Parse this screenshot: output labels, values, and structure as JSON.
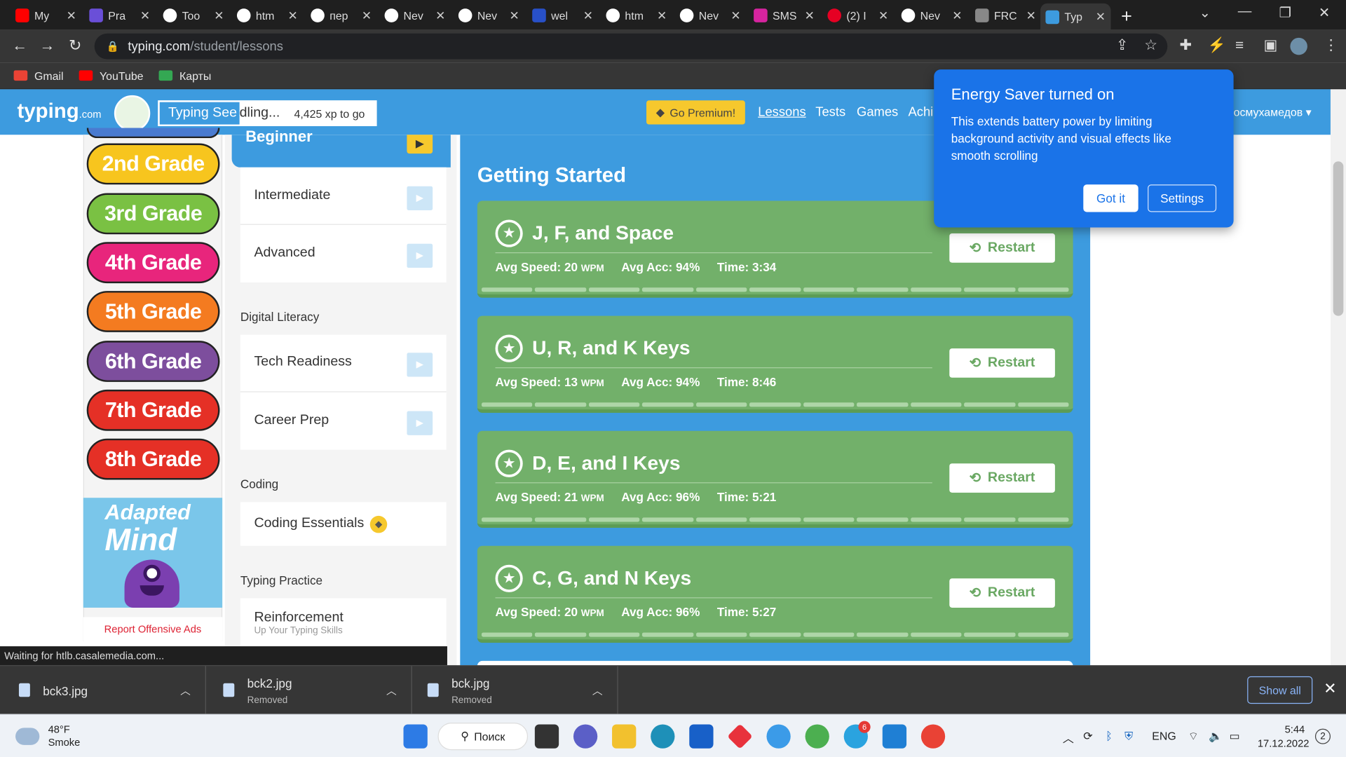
{
  "browser": {
    "tabs": [
      {
        "title": "My",
        "color": "#ff0000"
      },
      {
        "title": "Pra",
        "color": "#6a4fd8"
      },
      {
        "title": "Too",
        "color": "#ffffff"
      },
      {
        "title": "htm",
        "color": "#ffffff"
      },
      {
        "title": "пер",
        "color": "#ffffff"
      },
      {
        "title": "Nev",
        "color": "#ffffff"
      },
      {
        "title": "Nev",
        "color": "#ffffff"
      },
      {
        "title": "wel",
        "color": "#2850c8"
      },
      {
        "title": "htm",
        "color": "#ffffff"
      },
      {
        "title": "Nev",
        "color": "#ffffff"
      },
      {
        "title": "SMS",
        "color": "#d6249f"
      },
      {
        "title": "(2) I",
        "color": "#e60023"
      },
      {
        "title": "Nev",
        "color": "#ffffff"
      },
      {
        "title": "FRC",
        "color": "#888888"
      },
      {
        "title": "Typ",
        "color": "#3d9bdf"
      }
    ],
    "url_host": "typing.com",
    "url_path": "/student/lessons",
    "bookmarks": [
      {
        "label": "Gmail",
        "color": "#ea4335"
      },
      {
        "label": "YouTube",
        "color": "#ff0000"
      },
      {
        "label": "Карты",
        "color": "#34a853"
      }
    ]
  },
  "site": {
    "logo": "typing",
    "logo_suffix": ".com",
    "level_name_a": "Typing See",
    "level_name_b": "dling...",
    "xp_to_go": "4,425 xp to go",
    "premium": "Go Premium!",
    "nav": [
      "Lessons",
      "Tests",
      "Games",
      "Achi"
    ],
    "username": "осмухамедов"
  },
  "grades": [
    {
      "label": "2nd Grade",
      "color": "#f7c51e"
    },
    {
      "label": "3rd Grade",
      "color": "#7ac143"
    },
    {
      "label": "4th Grade",
      "color": "#e8257c"
    },
    {
      "label": "5th Grade",
      "color": "#f47b20"
    },
    {
      "label": "6th Grade",
      "color": "#7d4e9d"
    },
    {
      "label": "7th Grade",
      "color": "#e53026"
    },
    {
      "label": "8th Grade",
      "color": "#e53026"
    }
  ],
  "ad": {
    "line1": "Adapted",
    "line2": "Mind",
    "report": "Report Offensive Ads"
  },
  "courses": {
    "beginner": "Beginner",
    "intermediate": "Intermediate",
    "advanced": "Advanced",
    "digital_literacy": "Digital Literacy",
    "tech_readiness": "Tech Readiness",
    "career_prep": "Career Prep",
    "coding": "Coding",
    "coding_essentials": "Coding Essentials",
    "typing_practice": "Typing Practice",
    "reinforcement": "Reinforcement",
    "reinforcement_sub": "Up Your Typing Skills"
  },
  "lessons": {
    "section_title": "Getting Started",
    "restart_label": "Restart",
    "items": [
      {
        "name": "J, F, and Space",
        "speed": "Avg Speed: 20",
        "acc": "Avg Acc: 94%",
        "time": "Time: 3:34"
      },
      {
        "name": "U, R, and K Keys",
        "speed": "Avg Speed: 13",
        "acc": "Avg Acc: 94%",
        "time": "Time: 8:46"
      },
      {
        "name": "D, E, and I Keys",
        "speed": "Avg Speed: 21",
        "acc": "Avg Acc: 96%",
        "time": "Time: 5:21"
      },
      {
        "name": "C, G, and N Keys",
        "speed": "Avg Speed: 20",
        "acc": "Avg Acc: 96%",
        "time": "Time: 5:27"
      }
    ],
    "wpm": "WPM"
  },
  "energy_popup": {
    "title": "Energy Saver turned on",
    "body": "This extends battery power by limiting background activity and visual effects like smooth scrolling",
    "got_it": "Got it",
    "settings": "Settings"
  },
  "status_text": "Waiting for htlb.casalemedia.com...",
  "downloads": [
    {
      "name": "bck3.jpg",
      "state": ""
    },
    {
      "name": "bck2.jpg",
      "state": "Removed"
    },
    {
      "name": "bck.jpg",
      "state": "Removed"
    }
  ],
  "show_all": "Show all",
  "taskbar": {
    "temp": "48°F",
    "weather": "Smoke",
    "search": "Поиск",
    "lang": "ENG",
    "time": "5:44",
    "date": "17.12.2022",
    "notifications": "2",
    "telegram_badge": "6"
  }
}
